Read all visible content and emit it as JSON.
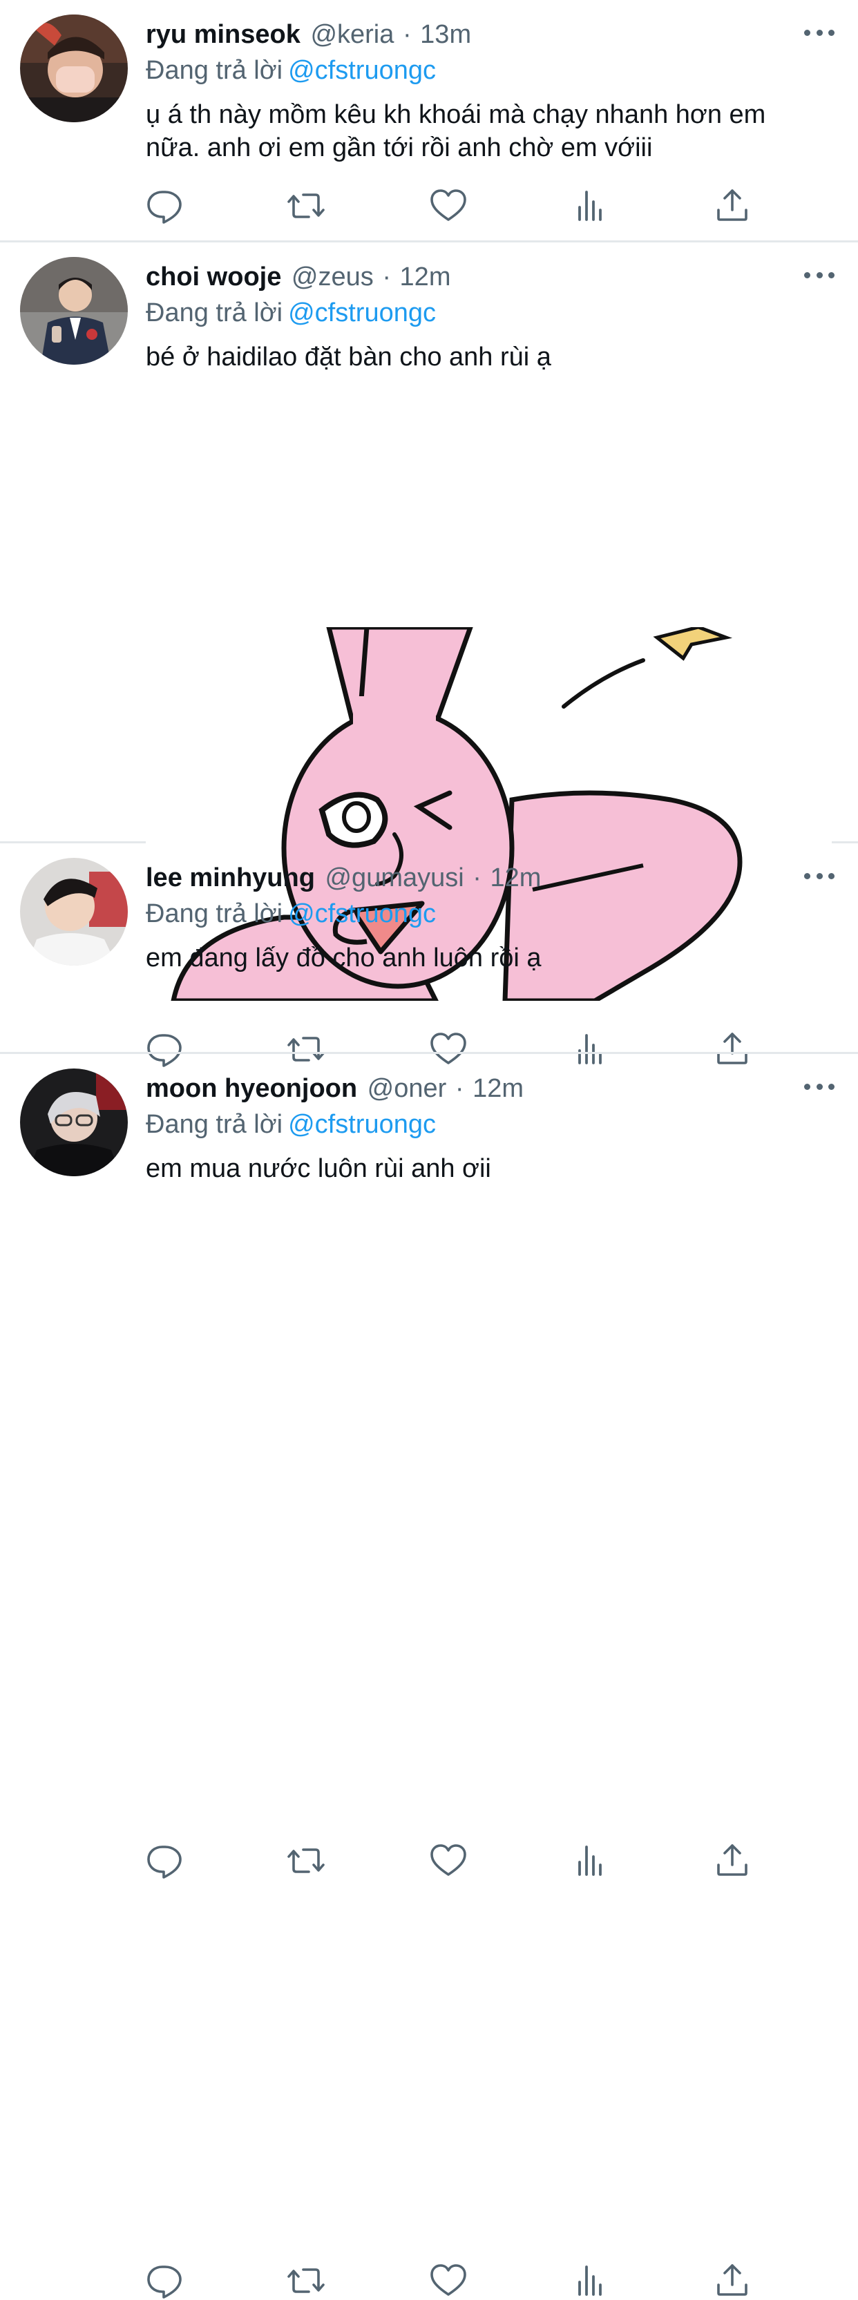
{
  "reply_prefix": "Đang trả lời",
  "tweets": [
    {
      "name": "ryu minseok",
      "handle": "@keria",
      "separator": "·",
      "time": "13m",
      "reply_to": "@cfstruongc",
      "text": "ụ á th này mồm kêu kh khoái mà chạy nhanh hơn em nữa. anh ơi em gần tới rồi anh chờ em vớiii"
    },
    {
      "name": "choi wooje",
      "handle": "@zeus",
      "separator": "·",
      "time": "12m",
      "reply_to": "@cfstruongc",
      "text": "bé ở haidilao đặt bàn cho anh rùi ạ"
    },
    {
      "name": "lee minhyung",
      "handle": "@gumayusi",
      "separator": "·",
      "time": "12m",
      "reply_to": "@cfstruongc",
      "text": "em đang lấy đồ cho anh luôn rồi ạ"
    },
    {
      "name": "moon hyeonjoon",
      "handle": "@oner",
      "separator": "·",
      "time": "12m",
      "reply_to": "@cfstruongc",
      "text": "em mua nước luôn rùi anh ơii"
    }
  ],
  "icons": {
    "reply": "speech-bubble-icon",
    "retweet": "retweet-icon",
    "like": "heart-icon",
    "views": "bar-chart-icon",
    "share": "share-upload-icon",
    "more": "ellipsis-icon"
  },
  "colors": {
    "link": "#1d9bf0",
    "muted": "#536471",
    "text": "#0f1419",
    "divider": "#e4e8eb",
    "sticker_pink": "#f6bfd6"
  }
}
